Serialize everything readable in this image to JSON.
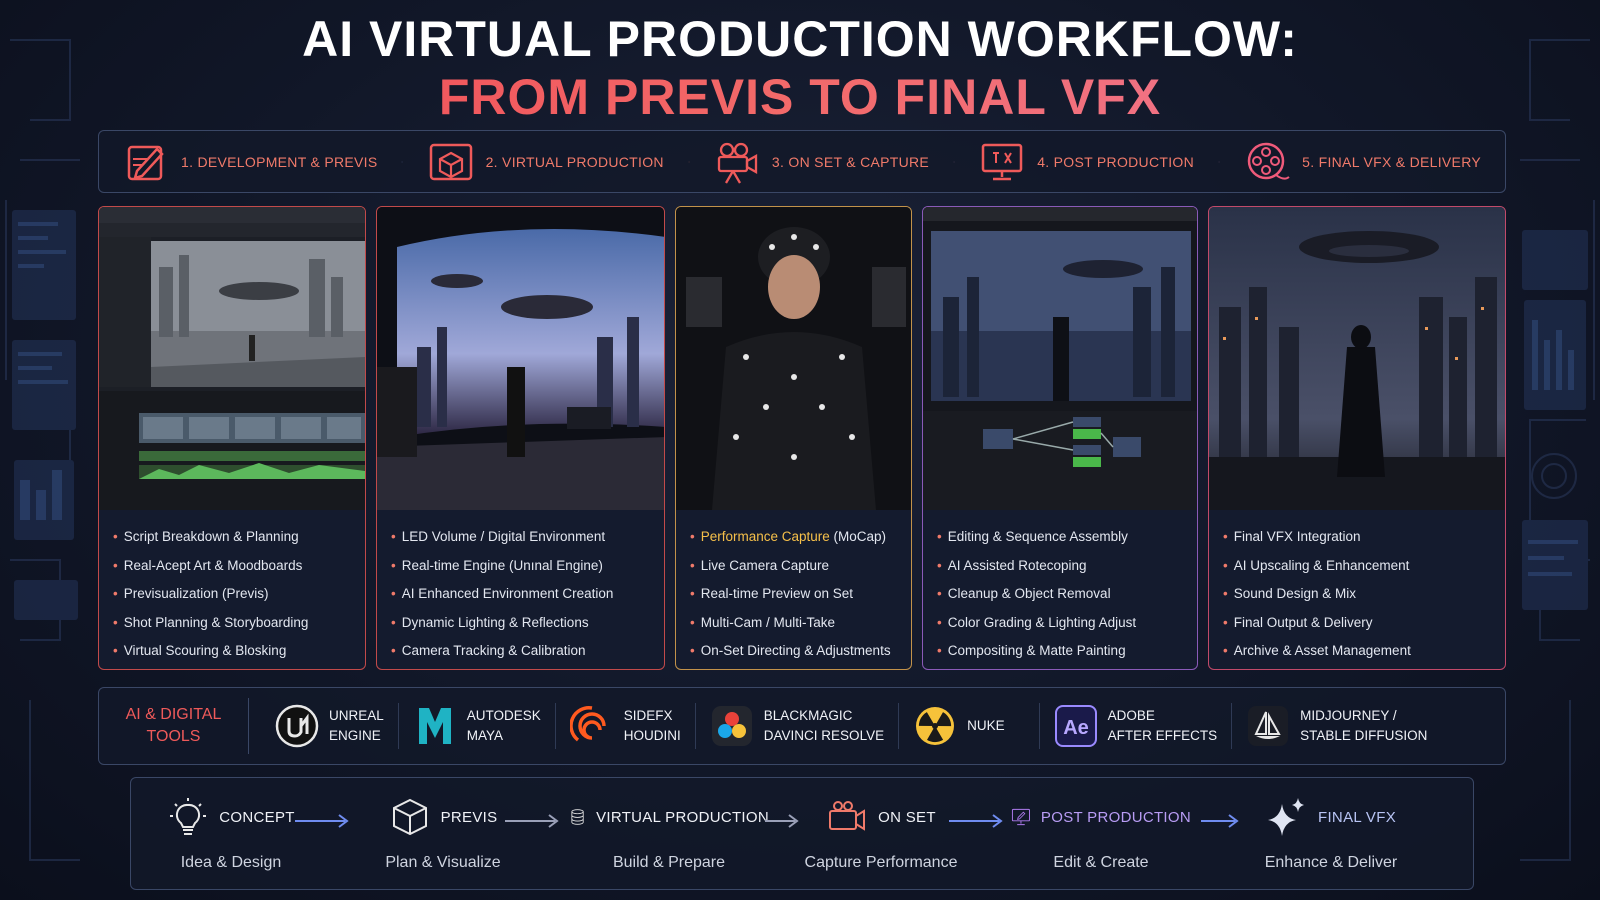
{
  "title": {
    "line1": "AI VIRTUAL PRODUCTION WORKFLOW:",
    "line2": "FROM PREVIS TO FINAL VFX"
  },
  "stages": [
    {
      "label": "1. DEVELOPMENT & PREVIS",
      "icon": "pencil-board-icon"
    },
    {
      "label": "2. VIRTUAL PRODUCTION",
      "icon": "cube-box-icon"
    },
    {
      "label": "3. ON SET & CAPTURE",
      "icon": "film-camera-icon"
    },
    {
      "label": "4. POST PRODUCTION",
      "icon": "monitor-icon"
    },
    {
      "label": "5. FINAL VFX & DELIVERY",
      "icon": "film-reel-icon"
    }
  ],
  "cards": [
    {
      "items": [
        "Script Breakdown & Planning",
        "Real-Acept Art & Moodboards",
        "Previsualization (Previs)",
        "Shot Planning & Storyboarding",
        "Virtual Scouring & Blosking"
      ]
    },
    {
      "items": [
        "LED Volume / Digital Environment",
        "Real-time Engine (Unınal Engine)",
        "AI Enhanced Environment Creation",
        "Dynamic Lighting & Reflections",
        "Camera Tracking & Calibration"
      ]
    },
    {
      "highlight": "Performance Capture",
      "highlight_rest": " (MoCap)",
      "items": [
        "Live Camera Capture",
        "Real-time Preview on Set",
        "Multi-Cam / Multi-Take",
        "On-Set Directing & Adjustments"
      ]
    },
    {
      "items": [
        "Editing & Sequence Assembly",
        "AI Assisted Rotecoping",
        "Cleanup & Object Removal",
        "Color Grading & Lighting Adjust",
        "Compositing & Matte Painting"
      ]
    },
    {
      "items": [
        "Final VFX Integration",
        "AI Upscaling & Enhancement",
        "Sound Design & Mix",
        "Final Output & Delivery",
        "Archive & Asset Management"
      ]
    }
  ],
  "tools": {
    "title_line1": "AI & DIGITAL",
    "title_line2": "TOOLS",
    "items": [
      {
        "line1": "UNREAL",
        "line2": "ENGINE",
        "icon": "unreal-engine-icon"
      },
      {
        "line1": "AUTODESK",
        "line2": "MAYA",
        "icon": "maya-icon"
      },
      {
        "line1": "SIDEFX",
        "line2": "HOUDINI",
        "icon": "houdini-icon"
      },
      {
        "line1": "BLACKMAGIC",
        "line2": "DAVINCI RESOLVE",
        "icon": "davinci-resolve-icon"
      },
      {
        "line1": "NUKE",
        "line2": "",
        "icon": "nuke-icon"
      },
      {
        "line1": "ADOBE",
        "line2": "AFTER EFFECTS",
        "icon": "after-effects-icon"
      },
      {
        "line1": "MIDJOURNEY /",
        "line2": "STABLE DIFFUSION",
        "icon": "midjourney-icon"
      }
    ],
    "ae_text": "Ae"
  },
  "flow": [
    {
      "name": "CONCEPT",
      "sub": "Idea & Design",
      "icon": "lightbulb-icon"
    },
    {
      "name": "PREVIS",
      "sub": "Plan & Visualize",
      "icon": "cube-icon"
    },
    {
      "name": "VIRTUAL PRODUCTION",
      "sub": "Build & Prepare",
      "icon": "database-icon"
    },
    {
      "name": "ON SET",
      "sub": "Capture Performance",
      "icon": "camera-icon"
    },
    {
      "name": "POST PRODUCTION",
      "sub": "Edit & Create",
      "icon": "monitor-edit-icon"
    },
    {
      "name": "FINAL VFX",
      "sub": "Enhance & Deliver",
      "icon": "sparkle-icon"
    }
  ],
  "colors": {
    "accent_red": "#ef4f5a",
    "accent_orange": "#f07a6a",
    "accent_gold": "#f6c04a",
    "accent_purple": "#b07cf0",
    "arrow_blue": "#6f8cf0",
    "border": "#3a4766",
    "background": "#111728"
  }
}
